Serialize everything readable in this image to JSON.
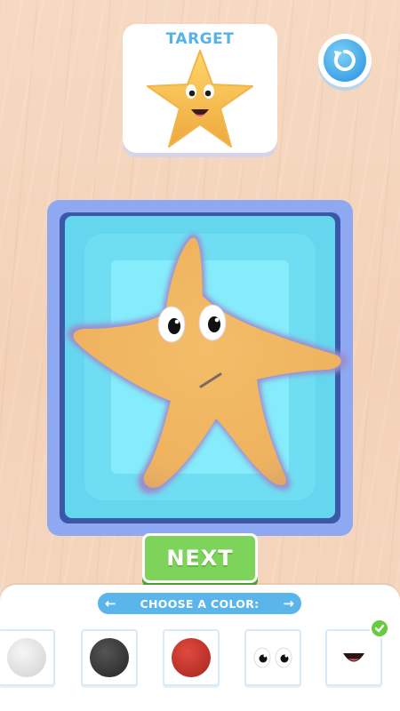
{
  "target": {
    "title": "TARGET",
    "star_color": "#f5c051",
    "star_shade": "#e3a23a"
  },
  "restart": {
    "icon": "restart-icon"
  },
  "canvas": {
    "tray_color": "#8fa8f2",
    "water_color": "#64d7ee",
    "shape_color": "#f0b862",
    "shape_rim": "#9a8ed0"
  },
  "next_button": {
    "label": "NEXT"
  },
  "palette": {
    "header": {
      "label": "CHOOSE A COLOR:",
      "left_icon": "arrow-left-icon",
      "right_icon": "arrow-right-icon"
    },
    "swatches": [
      {
        "name": "white",
        "color": "#ececec"
      },
      {
        "name": "black",
        "color": "#3a3a3a"
      },
      {
        "name": "red",
        "color": "#c8372f"
      },
      {
        "name": "eyes",
        "color": "#ffffff"
      },
      {
        "name": "mouth",
        "color": "#ffffff"
      }
    ],
    "selected_icon": "checkmark-icon"
  }
}
